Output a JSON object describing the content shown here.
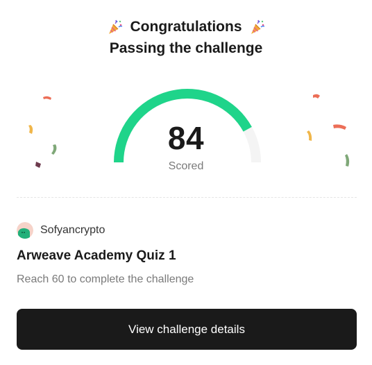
{
  "header": {
    "title": "Congratulations",
    "subtitle": "Passing the challenge",
    "icons": [
      "party-popper-icon",
      "party-popper-icon"
    ]
  },
  "gauge": {
    "score": "84",
    "score_value": 84,
    "max": 100,
    "label": "Scored",
    "fill_color": "#1fd48a",
    "track_color": "#f4f4f4"
  },
  "confetti_colors": [
    "#ec6e57",
    "#f0b64a",
    "#7fa878",
    "#6e3b4e"
  ],
  "challenge": {
    "creator": "Sofyancrypto",
    "title": "Arweave Academy Quiz 1",
    "description": "Reach 60 to complete the challenge"
  },
  "actions": {
    "view_details_label": "View challenge details"
  }
}
